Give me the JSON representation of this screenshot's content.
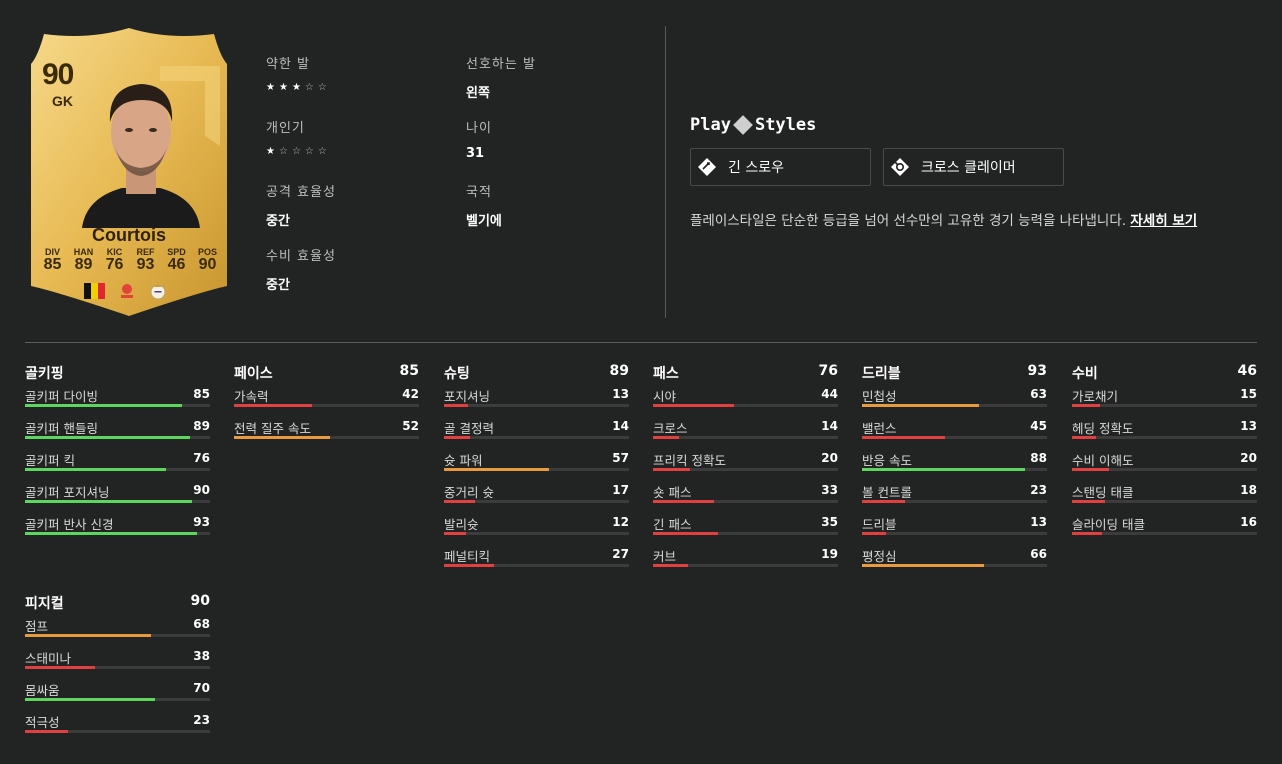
{
  "card": {
    "rating": "90",
    "position": "GK",
    "name": "Courtois",
    "stats": [
      {
        "label": "DIV",
        "value": "85"
      },
      {
        "label": "HAN",
        "value": "89"
      },
      {
        "label": "KIC",
        "value": "76"
      },
      {
        "label": "REF",
        "value": "93"
      },
      {
        "label": "SPD",
        "value": "46"
      },
      {
        "label": "POS",
        "value": "90"
      }
    ]
  },
  "info": {
    "weak_foot": {
      "label": "약한 발",
      "stars": 3,
      "max": 5
    },
    "preferred_foot": {
      "label": "선호하는 발",
      "value": "왼쪽"
    },
    "skill_moves": {
      "label": "개인기",
      "stars": 1,
      "max": 5
    },
    "age": {
      "label": "나이",
      "value": "31"
    },
    "att_work_rate": {
      "label": "공격 효율성",
      "value": "중간"
    },
    "nation": {
      "label": "국적",
      "value": "벨기에"
    },
    "def_work_rate": {
      "label": "수비 효율성",
      "value": "중간"
    }
  },
  "playstyles": {
    "title_left": "Play",
    "title_right": "Styles",
    "items": [
      {
        "label": "긴 스로우",
        "icon": "long-throw-icon"
      },
      {
        "label": "크로스 클레이머",
        "icon": "cross-claimer-icon"
      }
    ],
    "description": "플레이스타일은 단순한 등급을 넘어 선수만의 고유한 경기 능력을 나타냅니다.",
    "link": "자세히 보기"
  },
  "colors": {
    "green": "#5ed65e",
    "orange": "#e89a3c",
    "red": "#e04040"
  },
  "attributes": [
    {
      "title": "골키핑",
      "total": "",
      "items": [
        {
          "name": "골키퍼 다이빙",
          "value": 85
        },
        {
          "name": "골키퍼 핸들링",
          "value": 89
        },
        {
          "name": "골키퍼 킥",
          "value": 76
        },
        {
          "name": "골키퍼 포지셔닝",
          "value": 90
        },
        {
          "name": "골키퍼 반사 신경",
          "value": 93
        }
      ]
    },
    {
      "title": "페이스",
      "total": "85",
      "items": [
        {
          "name": "가속력",
          "value": 42
        },
        {
          "name": "전력 질주 속도",
          "value": 52
        }
      ]
    },
    {
      "title": "슈팅",
      "total": "89",
      "items": [
        {
          "name": "포지셔닝",
          "value": 13
        },
        {
          "name": "골 결정력",
          "value": 14
        },
        {
          "name": "슛 파워",
          "value": 57
        },
        {
          "name": "중거리 슛",
          "value": 17
        },
        {
          "name": "발리슛",
          "value": 12
        },
        {
          "name": "페널티킥",
          "value": 27
        }
      ]
    },
    {
      "title": "패스",
      "total": "76",
      "items": [
        {
          "name": "시야",
          "value": 44
        },
        {
          "name": "크로스",
          "value": 14
        },
        {
          "name": "프리킥 정확도",
          "value": 20
        },
        {
          "name": "숏 패스",
          "value": 33
        },
        {
          "name": "긴 패스",
          "value": 35
        },
        {
          "name": "커브",
          "value": 19
        }
      ]
    },
    {
      "title": "드리블",
      "total": "93",
      "items": [
        {
          "name": "민첩성",
          "value": 63
        },
        {
          "name": "밸런스",
          "value": 45
        },
        {
          "name": "반응 속도",
          "value": 88
        },
        {
          "name": "볼 컨트롤",
          "value": 23
        },
        {
          "name": "드리블",
          "value": 13
        },
        {
          "name": "평정심",
          "value": 66
        }
      ]
    },
    {
      "title": "수비",
      "total": "46",
      "items": [
        {
          "name": "가로채기",
          "value": 15
        },
        {
          "name": "헤딩 정확도",
          "value": 13
        },
        {
          "name": "수비 이해도",
          "value": 20
        },
        {
          "name": "스탠딩 태클",
          "value": 18
        },
        {
          "name": "슬라이딩 태클",
          "value": 16
        }
      ]
    },
    {
      "title": "피지컬",
      "total": "90",
      "items": [
        {
          "name": "점프",
          "value": 68
        },
        {
          "name": "스태미나",
          "value": 38
        },
        {
          "name": "몸싸움",
          "value": 70
        },
        {
          "name": "적극성",
          "value": 23
        }
      ]
    }
  ]
}
